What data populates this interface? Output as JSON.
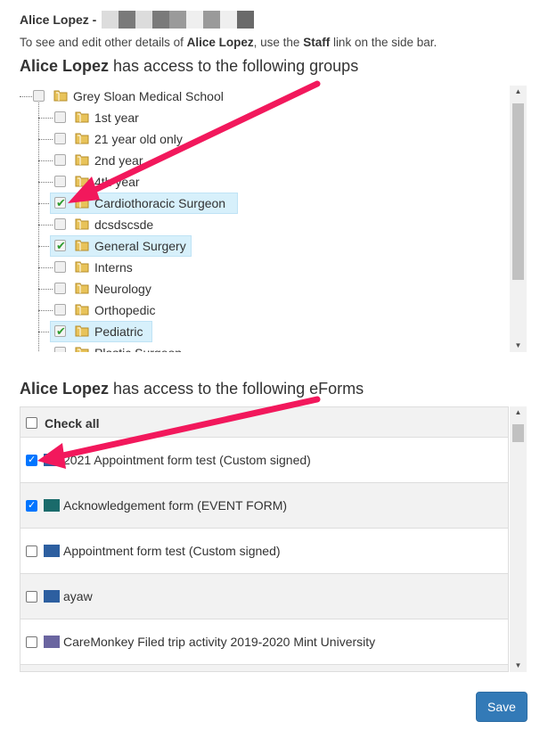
{
  "header": {
    "name": "Alice Lopez -",
    "redaction_colors": [
      "#dcdcdc",
      "#7a7a7a",
      "#dcdcdc",
      "#7a7a7a",
      "#9a9a9a",
      "#efefef",
      "#9a9a9a",
      "#efefef",
      "#6a6a6a"
    ]
  },
  "info": {
    "prefix": "To see and edit other details of ",
    "name": "Alice Lopez",
    "middle": ", use the ",
    "link": "Staff",
    "suffix": " link on the side bar."
  },
  "groups_section": {
    "name": "Alice Lopez",
    "title": " has access to the following groups"
  },
  "groups": {
    "root": "Grey Sloan Medical School",
    "items": [
      {
        "label": "1st year",
        "checked": false
      },
      {
        "label": "21 year old only",
        "checked": false
      },
      {
        "label": "2nd year",
        "checked": false
      },
      {
        "label": "4th year",
        "checked": false
      },
      {
        "label": "Cardiothoracic Surgeon",
        "checked": true
      },
      {
        "label": "dcsdscsde",
        "checked": false
      },
      {
        "label": "General Surgery",
        "checked": true
      },
      {
        "label": "Interns",
        "checked": false
      },
      {
        "label": "Neurology",
        "checked": false
      },
      {
        "label": "Orthopedic",
        "checked": false
      },
      {
        "label": "Pediatric",
        "checked": true
      },
      {
        "label": "Plastic Surgeon",
        "checked": false
      }
    ]
  },
  "eforms_section": {
    "name": "Alice Lopez",
    "title": " has access to the following eForms"
  },
  "eforms": {
    "check_all": "Check all",
    "items": [
      {
        "label": "2021 Appointment form test (Custom signed)",
        "checked": true,
        "color": "#2d5fa0"
      },
      {
        "label": "Acknowledgement form (EVENT FORM)",
        "checked": true,
        "color": "#1a6b6b"
      },
      {
        "label": "Appointment form test (Custom signed)",
        "checked": false,
        "color": "#2d5fa0"
      },
      {
        "label": "ayaw",
        "checked": false,
        "color": "#2d5fa0"
      },
      {
        "label": "CareMonkey Filed trip activity 2019-2020 Mint University",
        "checked": false,
        "color": "#6a65a0"
      }
    ]
  },
  "buttons": {
    "save": "Save"
  },
  "colors": {
    "accent": "#337ab7",
    "highlight": "#d7f0fb",
    "arrow": "#f2185c",
    "check_green": "#2e9c2e"
  },
  "icons": {
    "folder": "folder-icon",
    "checkmark": "checkmark-icon",
    "scroll_up": "scroll-up-icon",
    "scroll_down": "scroll-down-icon"
  }
}
